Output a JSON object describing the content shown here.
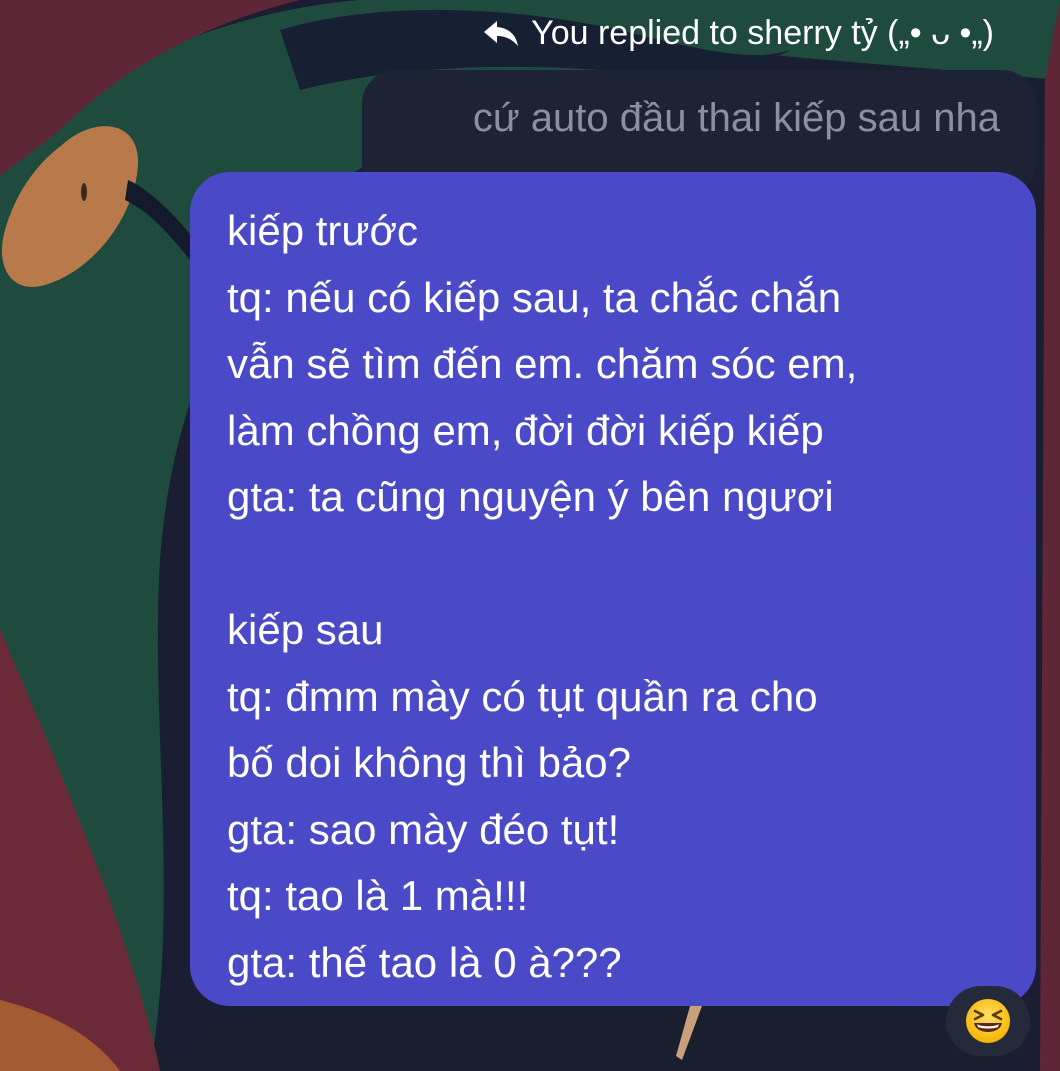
{
  "reply_header": {
    "icon": "reply-arrow-icon",
    "text": "You replied to sherry tỷ („• ᴗ •„)"
  },
  "quoted_message": {
    "text": "cứ auto đầu thai kiếp sau nha"
  },
  "message": {
    "lines": [
      "kiếp trước",
      "tq: nếu có kiếp sau, ta chắc chắn",
      "vẫn sẽ tìm đến em. chăm sóc em,",
      "làm chồng em, đời đời kiếp kiếp",
      "gta: ta cũng nguyện ý bên ngươi",
      "",
      "kiếp sau",
      "tq: đmm mày có tụt quần ra cho",
      "bố doi không thì bảo?",
      "gta: sao mày đéo tụt!",
      "tq: tao là 1 mà!!!",
      "gta: thế tao là 0 à???"
    ]
  },
  "reaction": {
    "icon": "grinning-squinting-face-emoji"
  },
  "colors": {
    "message_bubble": "#4a4ac8",
    "quoted_bubble": "#1e2235",
    "quoted_text": "#8c8f9f",
    "reaction_bubble": "#252a3b"
  }
}
